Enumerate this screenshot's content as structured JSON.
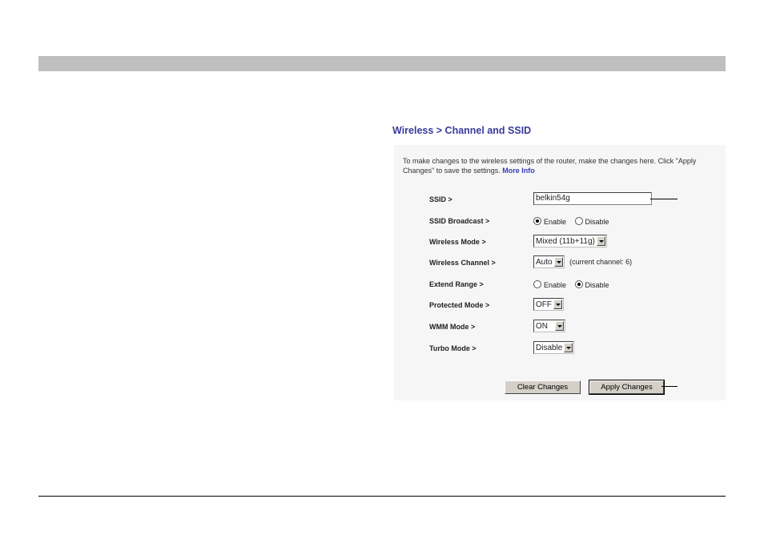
{
  "title": "Wireless > Channel and SSID",
  "intro": {
    "text": "To make changes to the wireless settings of the router, make the changes here. Click \"Apply Changes\" to save the settings.",
    "link": "More Info"
  },
  "rows": {
    "ssid": {
      "label": "SSID >",
      "value": "belkin54g"
    },
    "ssid_broadcast": {
      "label": "SSID Broadcast >",
      "options": [
        "Enable",
        "Disable"
      ],
      "selected": "Enable"
    },
    "wireless_mode": {
      "label": "Wireless Mode >",
      "value": "Mixed (11b+11g)"
    },
    "wireless_channel": {
      "label": "Wireless Channel >",
      "value": "Auto",
      "hint": "(current channel: 6)"
    },
    "extend_range": {
      "label": "Extend Range >",
      "options": [
        "Enable",
        "Disable"
      ],
      "selected": "Disable"
    },
    "protected_mode": {
      "label": "Protected Mode >",
      "value": "OFF"
    },
    "wmm_mode": {
      "label": "WMM Mode >",
      "value": "ON"
    },
    "turbo_mode": {
      "label": "Turbo Mode >",
      "value": "Disable"
    }
  },
  "buttons": {
    "clear": "Clear Changes",
    "apply": "Apply Changes"
  },
  "colors": {
    "title": "#3a3a9e",
    "link": "#3a3ab8",
    "panel_bg": "#f6f6f6",
    "top_bar": "#bfbfbf"
  }
}
